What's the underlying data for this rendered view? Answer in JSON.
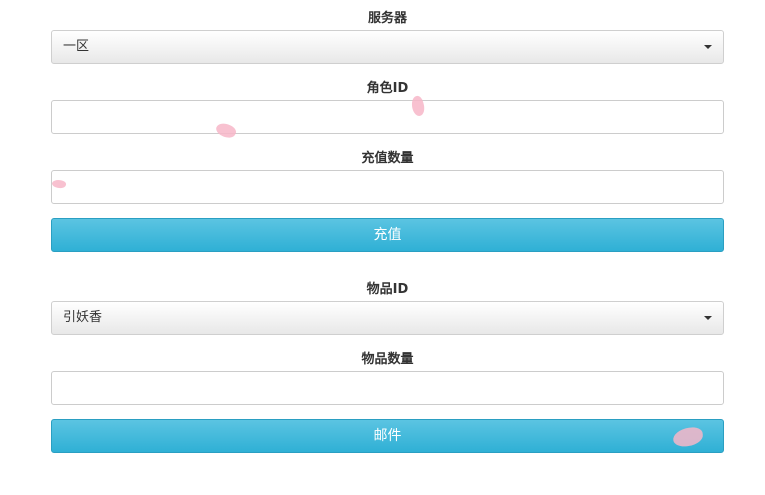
{
  "recharge": {
    "server_label": "服务器",
    "server_selected": "一区",
    "role_id_label": "角色ID",
    "role_id_value": "",
    "amount_label": "充值数量",
    "amount_value": "",
    "submit_label": "充值"
  },
  "mail": {
    "item_id_label": "物品ID",
    "item_selected": "引妖香",
    "quantity_label": "物品数量",
    "quantity_value": "",
    "submit_label": "邮件"
  },
  "colors": {
    "button_blue": "#31b0d5",
    "petal_pink": "#f7b6c8"
  }
}
